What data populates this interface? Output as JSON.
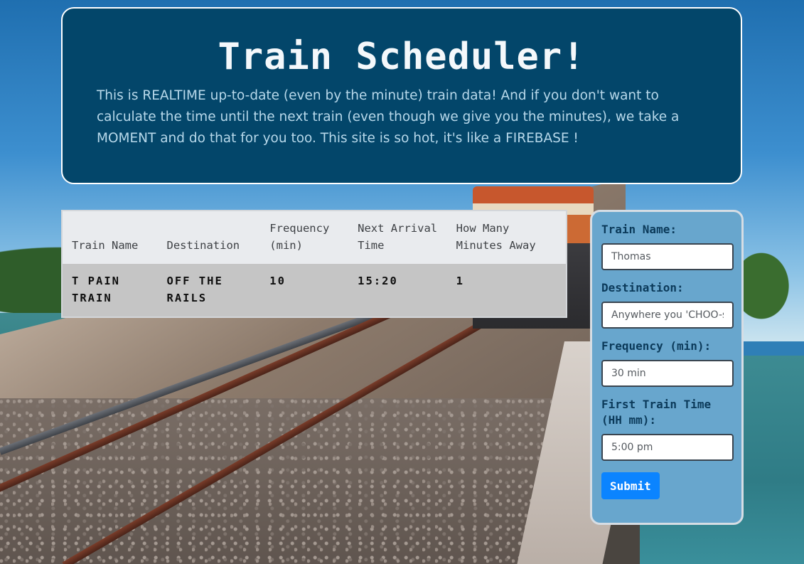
{
  "header": {
    "title": "Train Scheduler!",
    "intro": "This is REALTIME up-to-date (even by the minute) train data! And if you don't want to calculate the time until the next train (even though we give you the minutes), we take a MOMENT and do that for you too. This site is so hot, it's like a FIREBASE !"
  },
  "schedule": {
    "columns": [
      "Train Name",
      "Destination",
      "Frequency (min)",
      "Next Arrival Time",
      "How Many Minutes Away"
    ],
    "rows": [
      [
        "T PAIN TRAIN",
        "OFF THE RAILS",
        "10",
        "15:20",
        "1"
      ]
    ]
  },
  "form": {
    "train_name": {
      "label": "Train Name:",
      "placeholder": "Thomas"
    },
    "destination": {
      "label": "Destination:",
      "placeholder": "Anywhere you 'CHOO-se"
    },
    "frequency": {
      "label": "Frequency (min):",
      "placeholder": "30 min"
    },
    "first_train": {
      "label": "First Train Time (HH mm):",
      "placeholder": "5:00 pm"
    },
    "submit_label": "Submit"
  },
  "colors": {
    "header_bg": "#03466a",
    "form_bg": "#68a6cd",
    "submit_bg": "#0b84ff"
  }
}
